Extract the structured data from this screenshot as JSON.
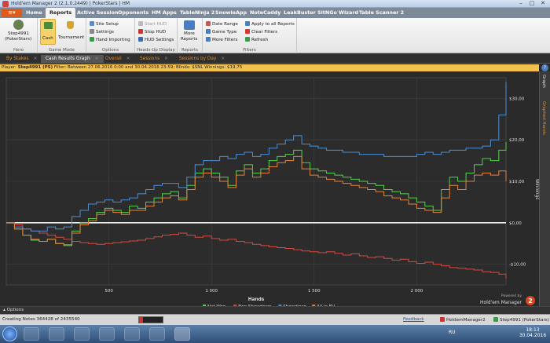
{
  "window": {
    "title": "Hold'em Manager 2 (2.1.0.2449) | PokerStars | HM"
  },
  "file_button": "▾",
  "ribbon_tabs": [
    "Home",
    "Reports",
    "Active Session",
    "Opponents",
    "HM Apps",
    "TableNinja 2",
    "SnowieApp",
    "NoteCaddy",
    "LeakBuster",
    "SitNGo Wizard",
    "Table Scanner 2"
  ],
  "ribbon": {
    "hero": {
      "player": "Step4991",
      "site": "(PokerStars)",
      "label": "Hero"
    },
    "game_mode": {
      "cash": "Cash",
      "tournament": "Tournament",
      "label": "Game Mode"
    },
    "options": {
      "items": [
        "Site Setup",
        "Settings",
        "Hand Importing"
      ],
      "label": "Options"
    },
    "hud": {
      "items": [
        "Start HUD",
        "Stop HUD",
        "HUD Settings"
      ],
      "label": "Heads-Up Display"
    },
    "reports": {
      "more1": "More",
      "more2": "Reports",
      "label": "Reports"
    },
    "filters": {
      "col1": [
        "Date Range",
        "Game Type",
        "More Filters"
      ],
      "col2": [
        "Apply to all Reports",
        "Clear Filters",
        "Refresh"
      ],
      "label": "Filters"
    }
  },
  "doc_tabs": [
    "By Stakes",
    "Cash Results Graph",
    "Overall",
    "Sessions",
    "Sessions by Day"
  ],
  "filter": {
    "player_label": "Player:",
    "player": "Step4991 (PS)",
    "filter_label": "Filter:",
    "filter_text": "Between 27.06.2016 0:00 and 30.04.2016 23:59; Blinds: $SNL",
    "winnings_label": "Winnings:",
    "winnings": "$19,75"
  },
  "help": "?",
  "rail": {
    "graph": "Graph",
    "graphed": "Graphed Hands"
  },
  "chart_data": {
    "type": "line",
    "xlabel": "Hands",
    "ylabel": "Winnings",
    "xlim": [
      0,
      2435
    ],
    "ylim": [
      -15,
      35
    ],
    "x_ticks": [
      500,
      1000,
      1500,
      2000
    ],
    "x_tick_labels": [
      "500",
      "1 000",
      "1 500",
      "2 000"
    ],
    "y_ticks": [
      30,
      20,
      10,
      0,
      -10
    ],
    "y_tick_labels": [
      "$30,00",
      "$20,00",
      "$10,00",
      "$0,00",
      "-$10,00"
    ],
    "legend": "bottom-center",
    "grid": true,
    "x": [
      0,
      40,
      80,
      120,
      160,
      200,
      240,
      280,
      320,
      360,
      400,
      440,
      480,
      520,
      560,
      600,
      640,
      680,
      720,
      760,
      800,
      840,
      880,
      920,
      960,
      1000,
      1040,
      1080,
      1120,
      1160,
      1200,
      1240,
      1280,
      1320,
      1360,
      1400,
      1440,
      1480,
      1520,
      1560,
      1600,
      1640,
      1680,
      1720,
      1760,
      1800,
      1840,
      1880,
      1920,
      1960,
      2000,
      2040,
      2080,
      2120,
      2160,
      2200,
      2240,
      2280,
      2320,
      2360,
      2400,
      2435
    ],
    "series": [
      {
        "name": "Net Won",
        "color": "#52d14c",
        "values": [
          0,
          -1.5,
          -3,
          -4.2,
          -4.5,
          -4,
          -5,
          -5.5,
          -2,
          0,
          1,
          2.5,
          3.5,
          3,
          2.5,
          4,
          3.5,
          5,
          6,
          7,
          7.5,
          6,
          9,
          12,
          13,
          12,
          11,
          9,
          12.5,
          14,
          12,
          13,
          15,
          16,
          16.5,
          17.5,
          14.5,
          13,
          12.5,
          12,
          11.5,
          11,
          10.5,
          10,
          9.5,
          9,
          8,
          7.5,
          7,
          6,
          5,
          4,
          3,
          8,
          11,
          10,
          12,
          14,
          15.5,
          15,
          17.5,
          19.5
        ]
      },
      {
        "name": "Non Showdown",
        "color": "#d84a3c",
        "values": [
          0,
          -0.5,
          -1.5,
          -2,
          -2.5,
          -3,
          -3.5,
          -4,
          -4.5,
          -4.8,
          -5,
          -5.2,
          -5,
          -4.8,
          -4.6,
          -4.4,
          -4.2,
          -3.8,
          -3.4,
          -3,
          -2.8,
          -2.5,
          -3,
          -3.5,
          -3.2,
          -3.8,
          -4.2,
          -4,
          -4.5,
          -4.8,
          -5.2,
          -5.5,
          -5.8,
          -6,
          -6.2,
          -6.5,
          -6.8,
          -7,
          -7.2,
          -7,
          -7.4,
          -7.8,
          -7.5,
          -8,
          -8.4,
          -8.2,
          -8.6,
          -9,
          -8.8,
          -9.4,
          -9.8,
          -9.5,
          -10,
          -10.4,
          -10.8,
          -11,
          -11.2,
          -11.4,
          -11.8,
          -12,
          -12.4,
          -13.5
        ]
      },
      {
        "name": "Showdown",
        "color": "#4a8fd6",
        "values": [
          0,
          -1,
          -1.5,
          -2,
          -2,
          -1,
          -1.5,
          -1,
          1.5,
          3,
          4.5,
          5,
          5.5,
          5,
          5.5,
          6,
          7,
          8,
          9,
          9.5,
          9.5,
          8.5,
          11,
          14,
          15,
          15,
          16,
          15.5,
          16.5,
          17,
          16,
          16.5,
          18,
          19,
          20,
          21,
          19,
          18.5,
          18,
          17.5,
          17.5,
          17,
          17,
          16.5,
          16.5,
          16.5,
          16,
          16,
          16,
          16,
          16.5,
          17,
          16.5,
          17,
          17.5,
          17.5,
          18,
          18,
          18.5,
          20,
          26,
          34
        ]
      },
      {
        "name": "All-in EV",
        "color": "#e4823a",
        "values": [
          0,
          -1.5,
          -3,
          -4,
          -4.5,
          -4,
          -5,
          -5.3,
          -2.5,
          -0.5,
          0.5,
          2,
          3,
          2.5,
          2,
          3,
          3,
          4,
          5,
          6,
          6.5,
          5.5,
          8,
          11,
          12,
          11,
          10,
          8.5,
          11.5,
          13,
          11,
          12,
          13.5,
          14.5,
          15,
          16,
          13,
          11.5,
          11,
          10.5,
          10,
          9.5,
          9,
          8.5,
          8,
          7.5,
          6.5,
          6,
          5.5,
          4.5,
          3.5,
          3,
          2.5,
          6,
          9,
          8,
          10,
          11.5,
          12,
          11.5,
          12.5,
          10
        ]
      }
    ]
  },
  "branding": {
    "powered": "Powered by",
    "name": "Hold'em Manager",
    "logo_digit": "2"
  },
  "options_label": "Options",
  "status": {
    "left": "Creating Notes 364428 of 2435540",
    "feedback": "Feedback",
    "app": "HoldemManager2",
    "player": "Step4991 (PokerStars)"
  },
  "taskbar": {
    "lang": "RU",
    "time": "18:13",
    "date": "30.04.2016"
  }
}
